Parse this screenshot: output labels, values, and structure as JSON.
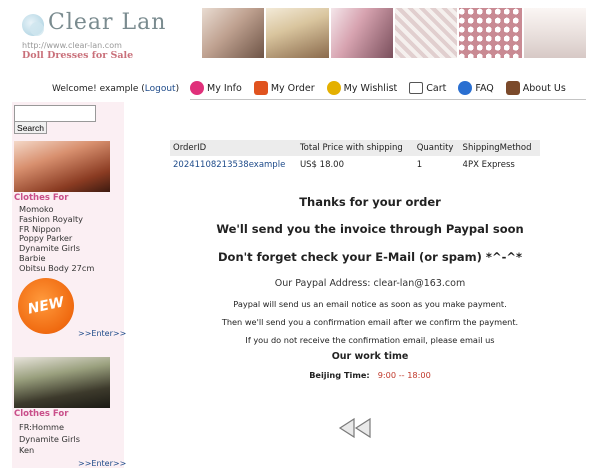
{
  "header": {
    "logo_text": "Clear Lan",
    "logo_url": "http://www.clear-lan.com",
    "logo_tagline": "Doll Dresses for Sale"
  },
  "user": {
    "welcome_prefix": "Welcome! example (",
    "logout_label": "Logout",
    "welcome_suffix": ")"
  },
  "nav": [
    {
      "label": "My Info",
      "icon": "info-icon",
      "color": "#e0307a"
    },
    {
      "label": "My Order",
      "icon": "order-icon",
      "color": "#e0531f"
    },
    {
      "label": "My Wishlist",
      "icon": "wishlist-icon",
      "color": "#e4b000"
    },
    {
      "label": "Cart",
      "icon": "cart-icon",
      "color": "#555555"
    },
    {
      "label": "FAQ",
      "icon": "faq-icon",
      "color": "#2a6fd1"
    },
    {
      "label": "About Us",
      "icon": "house-icon",
      "color": "#7b4a2b"
    }
  ],
  "search": {
    "placeholder": "",
    "button_label": "Search"
  },
  "sidebar": {
    "section1": {
      "title": "Clothes For",
      "items": [
        "Momoko",
        "Fashion Royalty",
        "FR Nippon",
        "Poppy Parker",
        "Dynamite Girls",
        "Barbie",
        "Obitsu Body 27cm"
      ],
      "badge": "NEW",
      "enter_label": ">>Enter>>"
    },
    "section2": {
      "title": "Clothes For",
      "items": [
        "FR:Homme",
        "Dynamite Girls",
        "Ken"
      ],
      "enter_label": ">>Enter>>"
    }
  },
  "order": {
    "headers": [
      "OrderID",
      "Total Price with shipping",
      "Quantity",
      "ShippingMethod"
    ],
    "rows": [
      {
        "id": "20241108213538example",
        "price": "US$ 18.00",
        "qty": "1",
        "method": "4PX Express"
      }
    ]
  },
  "messages": {
    "thanks": "Thanks for your order",
    "invoice": "We'll send you the invoice through Paypal soon",
    "check_email": "Don't forget check your E-Mail (or spam) *^-^*",
    "paypal_address": "Our Paypal Address: clear-lan@163.com",
    "notice1": "Paypal will send us an email notice as soon as you make payment.",
    "notice2": "Then we'll send you a confirmation email after we confirm the payment.",
    "notice3": "If you do not receive the confirmation email, please email us",
    "work_time_title": "Our work time",
    "beijing_label": "Beijing Time:",
    "beijing_hours": "9:00 -- 18:00"
  },
  "colors": {
    "link": "#1e4b8a",
    "sidebar_bg": "#fbeff3",
    "category_title": "#c94f8a",
    "time_red": "#c0392b"
  }
}
